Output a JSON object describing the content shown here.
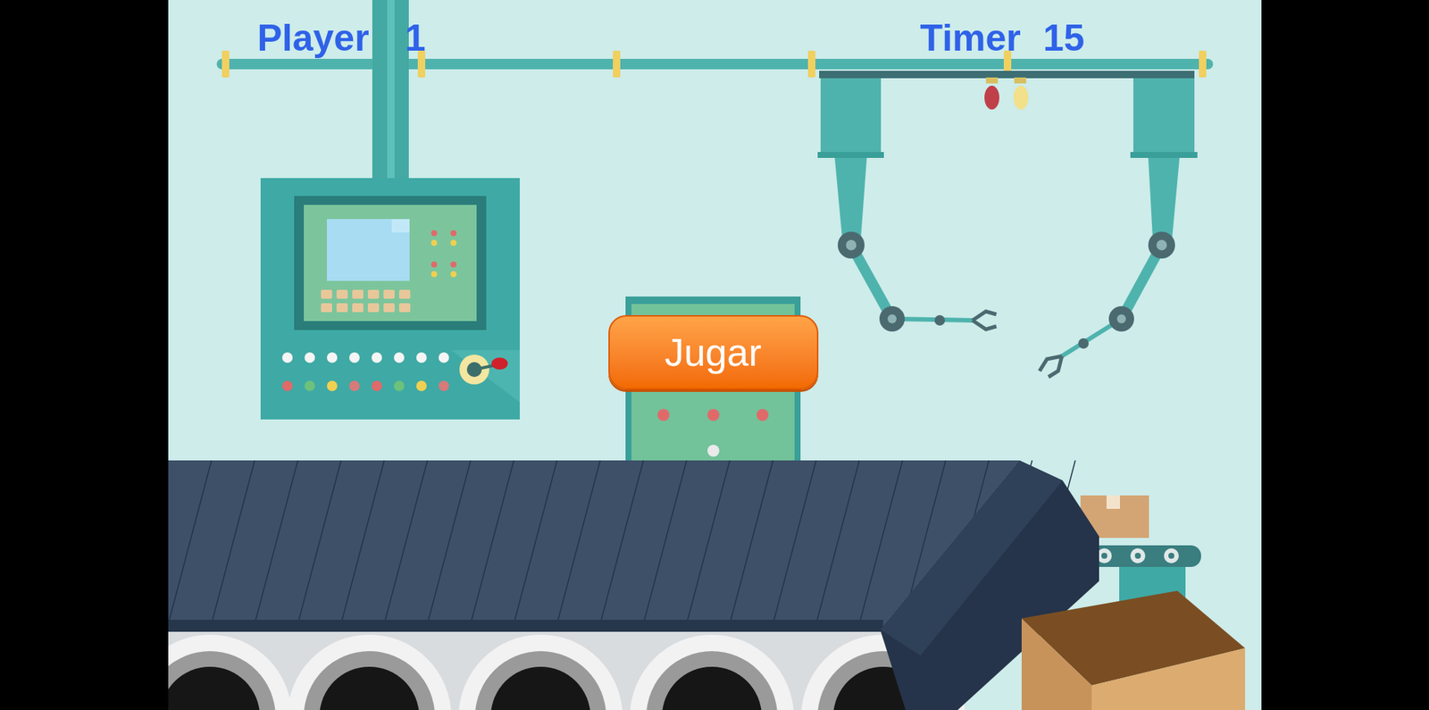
{
  "hud": {
    "player_label": "Player",
    "player": "1",
    "timer_label": "Timer",
    "timer": "15"
  },
  "start_button": {
    "label": "Jugar"
  }
}
